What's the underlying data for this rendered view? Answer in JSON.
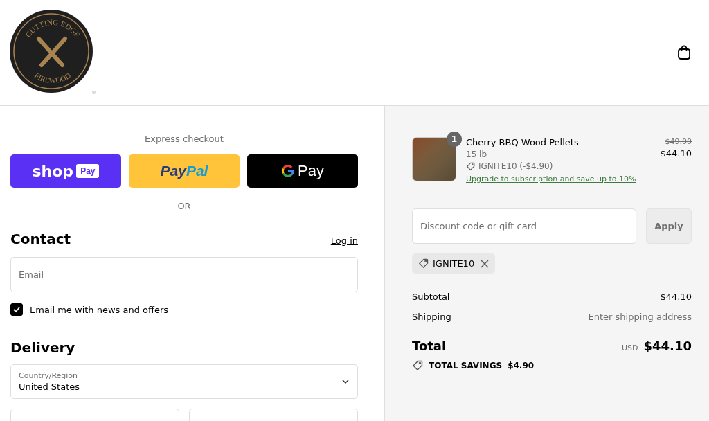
{
  "logo": {
    "top_text": "CUTTING EDGE",
    "bottom_text": "FIREWOOD",
    "mark": "®"
  },
  "express_checkout": {
    "title": "Express checkout",
    "shop_pay": {
      "word": "shop",
      "badge": "Pay"
    },
    "paypal": {
      "first": "Pay",
      "second": "Pal"
    },
    "google_pay": {
      "label": "Pay"
    },
    "divider": "OR"
  },
  "contact": {
    "heading": "Contact",
    "login_link": "Log in",
    "email": {
      "placeholder": "Email"
    },
    "newsletter": {
      "label": "Email me with news and offers",
      "checked": true
    }
  },
  "delivery": {
    "heading": "Delivery",
    "country": {
      "label": "Country/Region",
      "value": "United States"
    }
  },
  "order": {
    "items": [
      {
        "quantity": "1",
        "name": "Cherry BBQ Wood Pellets",
        "variant": "15 lb",
        "discount": "IGNITE10 (-$4.90)",
        "upgrade_link": "Upgrade to subscription and save up to 10%",
        "original_price": "$49.00",
        "price": "$44.10"
      }
    ],
    "discount_field": {
      "placeholder": "Discount code or gift card"
    },
    "apply_button": "Apply",
    "applied_codes": [
      {
        "code": "IGNITE10"
      }
    ],
    "summary": [
      {
        "label": "Subtotal",
        "value": "$44.10",
        "kind": "amount"
      },
      {
        "label": "Shipping",
        "value": "Enter shipping address",
        "kind": "hint"
      }
    ],
    "total": {
      "label": "Total",
      "currency": "USD",
      "value": "$44.10"
    },
    "savings": {
      "label": "TOTAL SAVINGS",
      "value": "$4.90"
    }
  }
}
